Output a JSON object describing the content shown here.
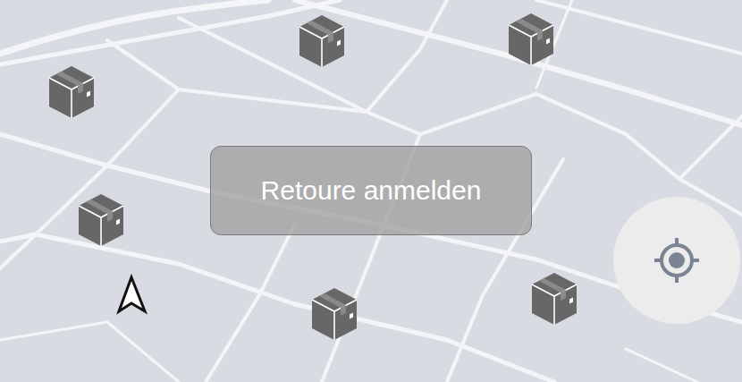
{
  "map": {
    "pins": [
      {
        "kind": "package"
      },
      {
        "kind": "package"
      },
      {
        "kind": "package"
      },
      {
        "kind": "package"
      },
      {
        "kind": "package"
      },
      {
        "kind": "package"
      }
    ]
  },
  "return_button": {
    "label": "Retoure anmelden"
  }
}
